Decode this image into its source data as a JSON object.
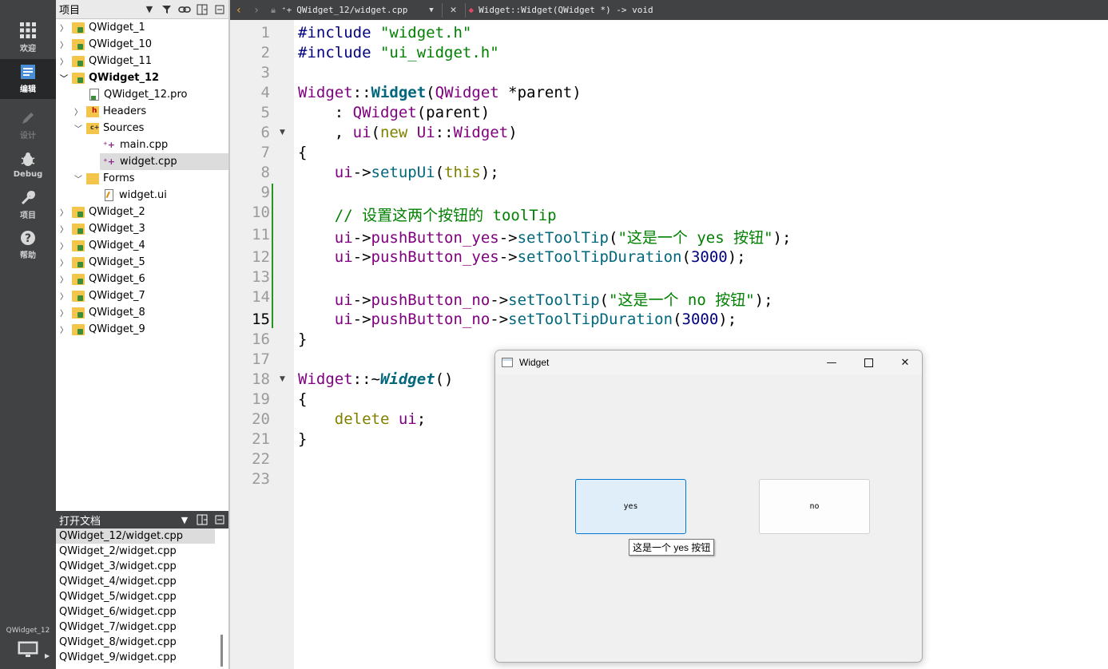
{
  "modebar": {
    "items": [
      {
        "label": "欢迎",
        "icon": "grid-icon"
      },
      {
        "label": "编辑",
        "icon": "edit-icon"
      },
      {
        "label": "设计",
        "icon": "pencil-icon"
      },
      {
        "label": "Debug",
        "icon": "bug-icon"
      },
      {
        "label": "项目",
        "icon": "wrench-icon"
      },
      {
        "label": "帮助",
        "icon": "help-icon"
      }
    ],
    "kit_label": "QWidget_12"
  },
  "project_panel": {
    "title": "项目",
    "tree": [
      {
        "label": "QWidget_1",
        "expanded": false
      },
      {
        "label": "QWidget_10",
        "expanded": false
      },
      {
        "label": "QWidget_11",
        "expanded": false
      },
      {
        "label": "QWidget_12",
        "expanded": true
      },
      {
        "label": "QWidget_12.pro"
      },
      {
        "label": "Headers",
        "expanded": false
      },
      {
        "label": "Sources",
        "expanded": true
      },
      {
        "label": "main.cpp"
      },
      {
        "label": "widget.cpp",
        "selected": true
      },
      {
        "label": "Forms",
        "expanded": true
      },
      {
        "label": "widget.ui"
      },
      {
        "label": "QWidget_2",
        "expanded": false
      },
      {
        "label": "QWidget_3",
        "expanded": false
      },
      {
        "label": "QWidget_4",
        "expanded": false
      },
      {
        "label": "QWidget_5",
        "expanded": false
      },
      {
        "label": "QWidget_6",
        "expanded": false
      },
      {
        "label": "QWidget_7",
        "expanded": false
      },
      {
        "label": "QWidget_8",
        "expanded": false
      },
      {
        "label": "QWidget_9",
        "expanded": false
      }
    ]
  },
  "open_documents": {
    "title": "打开文档",
    "items": [
      "QWidget_12/widget.cpp",
      "QWidget_2/widget.cpp",
      "QWidget_3/widget.cpp",
      "QWidget_4/widget.cpp",
      "QWidget_5/widget.cpp",
      "QWidget_6/widget.cpp",
      "QWidget_7/widget.cpp",
      "QWidget_8/widget.cpp",
      "QWidget_9/widget.cpp"
    ]
  },
  "editor_toolbar": {
    "document": "QWidget_12/widget.cpp",
    "symbol": "Widget::Widget(QWidget *) -> void"
  },
  "editor": {
    "current_line": "15",
    "line_numbers": [
      "1",
      "2",
      "3",
      "4",
      "5",
      "6",
      "7",
      "8",
      "9",
      "10",
      "11",
      "12",
      "13",
      "14",
      "15",
      "16",
      "17",
      "18",
      "19",
      "20",
      "21",
      "22",
      "23"
    ],
    "code": {
      "l1a": "#include ",
      "l1b": "\"widget.h\"",
      "l2a": "#include ",
      "l2b": "\"ui_widget.h\"",
      "l4a": "Widget",
      "l4b": "::",
      "l4c": "Widget",
      "l4d": "(",
      "l4e": "QWidget",
      "l4f": " *parent)",
      "l5a": "    : ",
      "l5b": "QWidget",
      "l5c": "(parent)",
      "l6a": "    , ",
      "l6b": "ui",
      "l6c": "(",
      "l6d": "new",
      "l6e": " ",
      "l6f": "Ui",
      "l6g": "::",
      "l6h": "Widget",
      "l6i": ")",
      "l7": "{",
      "l8a": "    ",
      "l8b": "ui",
      "l8c": "->",
      "l8d": "setupUi",
      "l8e": "(",
      "l8f": "this",
      "l8g": ");",
      "l10": "    // 设置这两个按钮的 toolTip",
      "l11a": "    ",
      "l11b": "ui",
      "l11c": "->",
      "l11d": "pushButton_yes",
      "l11e": "->",
      "l11f": "setToolTip",
      "l11g": "(",
      "l11h": "\"这是一个 yes 按钮\"",
      "l11i": ");",
      "l12a": "    ",
      "l12b": "ui",
      "l12c": "->",
      "l12d": "pushButton_yes",
      "l12e": "->",
      "l12f": "setToolTipDuration",
      "l12g": "(",
      "l12h": "3000",
      "l12i": ");",
      "l14a": "    ",
      "l14b": "ui",
      "l14c": "->",
      "l14d": "pushButton_no",
      "l14e": "->",
      "l14f": "setToolTip",
      "l14g": "(",
      "l14h": "\"这是一个 no 按钮\"",
      "l14i": ");",
      "l15a": "    ",
      "l15b": "ui",
      "l15c": "->",
      "l15d": "pushButton_no",
      "l15e": "->",
      "l15f": "setToolTipDuration",
      "l15g": "(",
      "l15h": "3000",
      "l15i": ");",
      "l16": "}",
      "l18a": "Widget",
      "l18b": "::~",
      "l18c": "Widget",
      "l18d": "()",
      "l19": "{",
      "l20a": "    ",
      "l20b": "delete",
      "l20c": " ",
      "l20d": "ui",
      "l20e": ";",
      "l21": "}"
    }
  },
  "widget_window": {
    "title": "Widget",
    "button_yes": "yes",
    "button_no": "no",
    "tooltip": "这是一个 yes 按钮"
  }
}
